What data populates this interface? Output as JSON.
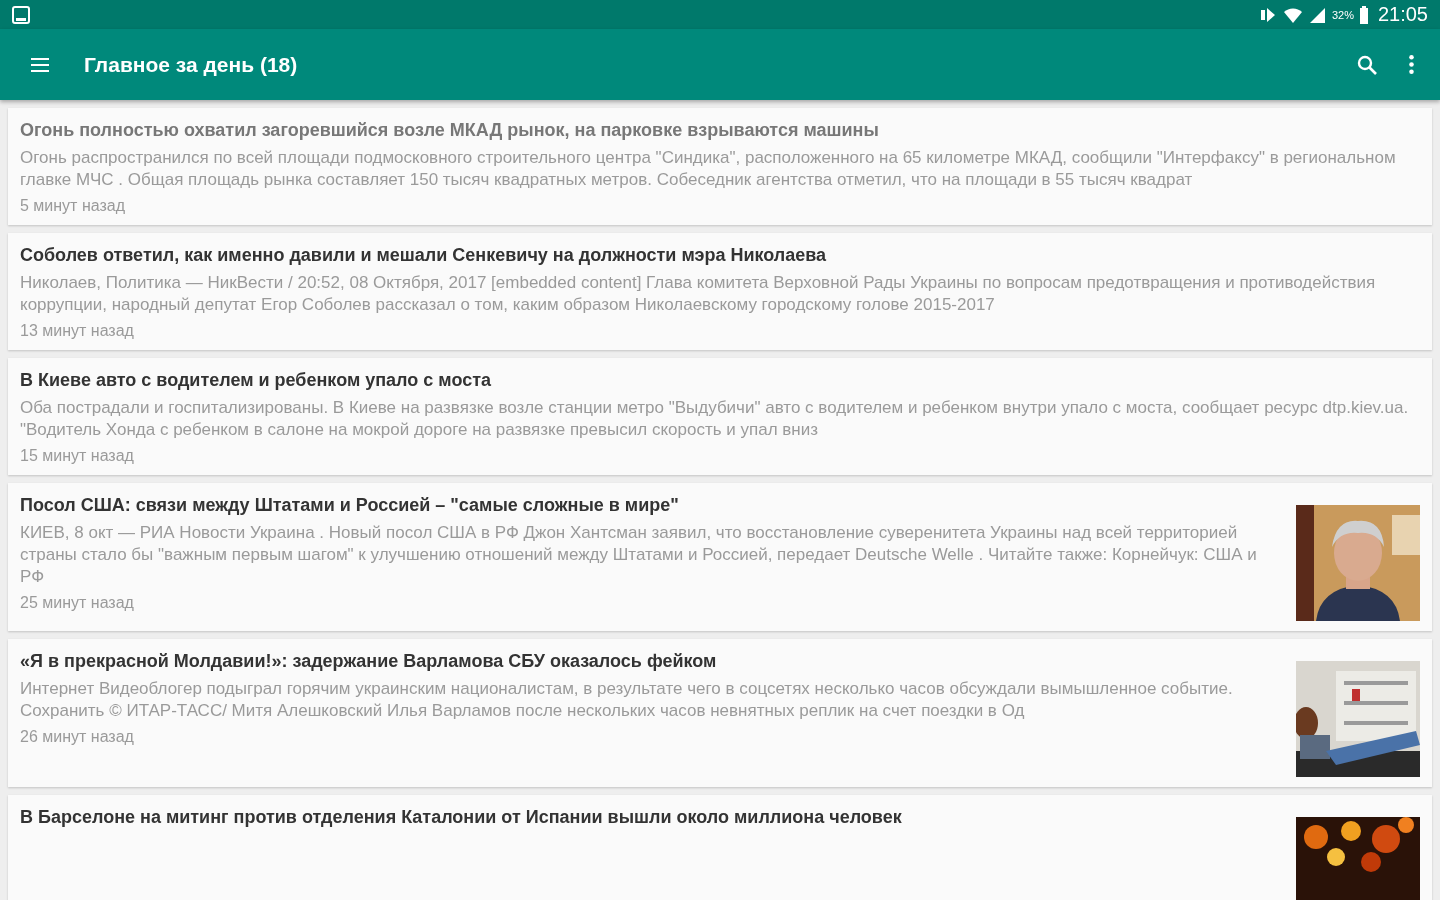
{
  "status_bar": {
    "battery_text": "32%",
    "time": "21:05"
  },
  "app_bar": {
    "title": "Главное за день (18)"
  },
  "articles": [
    {
      "title": "Огонь полностью охватил загоревшийся возле МКАД рынок, на парковке взрываются машины",
      "summary": "Огонь распространился по всей площади подмосковного строительного центра \"Синдика\", расположенного на 65 километре МКАД, сообщили  \"Интерфаксу\" в региональном главке МЧС . Общая площадь рынка составляет 150 тысяч квадратных метров. Собеседник агентства отметил, что на площади в 55 тысяч квадрат",
      "time": "5 минут назад",
      "read": true
    },
    {
      "title": "Соболев ответил, как именно давили и мешали Сенкевичу на должности мэра Николаева",
      "summary": "Николаев,       Политика — НикВести / 20:52, 08 Октября, 2017                    [embedded content] Глава комитета Верховной Рады Украины по вопросам предотвращения и противодействия коррупции, народный депутат Егор Соболев рассказал о том, каким образом Николаевскому городскому голове 2015-2017",
      "time": "13 минут назад",
      "read": false
    },
    {
      "title": "В Киеве авто с водителем и ребенком упало с моста",
      "summary": "Оба пострадали и госпитализированы.    В Киеве на развязке возле станции метро \"Выдубичи\" авто с водителем и ребенком внутри упало с моста, сообщает ресурс dtp.kiev.ua.     \"Водитель Хонда с ребенком в салоне на мокрой дороге на развязке превысил скорость и упал вниз",
      "time": "15 минут назад",
      "read": false
    },
    {
      "title": "Посол США: связи между Штатами и Россией – \"самые сложные в мире\"",
      "summary": "КИЕВ, 8 окт —  РИА Новости Украина . Новый посол США в РФ Джон Хантсман заявил, что восстановление суверенитета Украины над всей территорией страны стало бы \"важным первым шагом\" к улучшению отношений между Штатами и Россией, передает Deutsche Welle . Читайте также: Корнейчук: США и РФ",
      "time": "25 минут назад",
      "read": false,
      "image": {
        "kind": "portrait"
      }
    },
    {
      "title": "«Я в прекрасной Молдавии!»: задержание Варламова СБУ оказалось фейком",
      "summary": "Интернет Видеоблогер подыграл горячим украинским националистам, в результате чего в соцсетях несколько часов обсуждали вымышленное событие. Сохранить © ИТАР-ТАСС/ Митя Алешковский Илья Варламов после нескольких часов невнятных реплик на счет поездки в Од",
      "time": "26 минут назад",
      "read": false,
      "image": {
        "kind": "room"
      }
    },
    {
      "title": "В Барселоне на митинг против отделения Каталонии от Испании вышли около миллиона человек",
      "read": false,
      "image": {
        "kind": "fire"
      }
    }
  ]
}
